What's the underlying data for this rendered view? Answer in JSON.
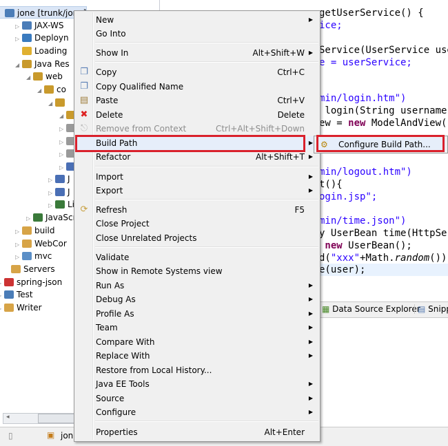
{
  "tree": {
    "items": [
      {
        "label": "jone [trunk/jone]",
        "selected": true
      },
      {
        "label": "JAX-WS"
      },
      {
        "label": "Deployn"
      },
      {
        "label": "Loading"
      },
      {
        "label": "Java Res"
      },
      {
        "label": "web"
      },
      {
        "label": "co"
      },
      {
        "label": ""
      },
      {
        "label": ""
      },
      {
        "label": ""
      },
      {
        "label": ""
      },
      {
        "label": ""
      },
      {
        "label": "J"
      },
      {
        "label": "J"
      },
      {
        "label": "J"
      },
      {
        "label": "Libra"
      },
      {
        "label": "JavaScri"
      },
      {
        "label": "build"
      },
      {
        "label": "WebCor"
      },
      {
        "label": "mvc"
      },
      {
        "label": "Servers"
      },
      {
        "label": "spring-json"
      },
      {
        "label": "Test"
      },
      {
        "label": "Writer"
      }
    ],
    "scroll_grip": "III"
  },
  "status": {
    "project": "jon"
  },
  "editor": {
    "lines": {
      "l1": "getUserService() {",
      "l2": "ice;",
      "l3": "Service(UserService use",
      "l4": "e = userService;",
      "l5": "min/login.htm\")",
      "l6a": " login(String username",
      "l7a": "ew = ",
      "l7k": "new",
      "l7b": " ModelAndView(\"",
      "l8": "min/logout.htm\")",
      "l9": "t(){",
      "l10": "ogin.jsp\";",
      "l11": "min/time.json\")",
      "l12": "y UserBean time(HttpSer",
      "l13k": " new",
      "l13b": " UserBean();",
      "l14a": "d(",
      "l14s": "\"xxx\"",
      "l14b": "+Math.",
      "l14i": "random",
      "l14c": "())",
      "l15": "e(user);"
    }
  },
  "bottom_tabs": [
    "Data Source Explorer",
    "Snipp"
  ],
  "context_menu": {
    "items": [
      {
        "label": "New",
        "submenu": true
      },
      {
        "label": "Go Into"
      },
      {
        "label": "Show In",
        "shortcut": "Alt+Shift+W",
        "submenu": true
      },
      {
        "label": "Copy",
        "shortcut": "Ctrl+C",
        "icon": "copy-icon"
      },
      {
        "label": "Copy Qualified Name",
        "icon": "copy-qualified-icon"
      },
      {
        "label": "Paste",
        "shortcut": "Ctrl+V",
        "icon": "paste-icon"
      },
      {
        "label": "Delete",
        "shortcut": "Delete",
        "icon": "delete-icon"
      },
      {
        "label": "Remove from Context",
        "shortcut": "Ctrl+Alt+Shift+Down",
        "disabled": true
      },
      {
        "label": "Build Path",
        "submenu": true,
        "highlighted": true
      },
      {
        "label": "Refactor",
        "shortcut": "Alt+Shift+T",
        "submenu": true
      },
      {
        "label": "Import",
        "submenu": true
      },
      {
        "label": "Export",
        "submenu": true
      },
      {
        "label": "Refresh",
        "shortcut": "F5",
        "icon": "refresh-icon"
      },
      {
        "label": "Close Project"
      },
      {
        "label": "Close Unrelated Projects"
      },
      {
        "label": "Validate"
      },
      {
        "label": "Show in Remote Systems view"
      },
      {
        "label": "Run As",
        "submenu": true
      },
      {
        "label": "Debug As",
        "submenu": true
      },
      {
        "label": "Profile As",
        "submenu": true
      },
      {
        "label": "Team",
        "submenu": true
      },
      {
        "label": "Compare With",
        "submenu": true
      },
      {
        "label": "Replace With",
        "submenu": true
      },
      {
        "label": "Restore from Local History..."
      },
      {
        "label": "Java EE Tools",
        "submenu": true
      },
      {
        "label": "Source",
        "submenu": true
      },
      {
        "label": "Configure",
        "submenu": true
      },
      {
        "label": "Properties",
        "shortcut": "Alt+Enter"
      }
    ]
  },
  "submenu": {
    "label": "Configure Build Path..."
  },
  "colors": {
    "highlight_box": "#d9202b",
    "keyword": "#7f0055",
    "string": "#2a00ff"
  }
}
